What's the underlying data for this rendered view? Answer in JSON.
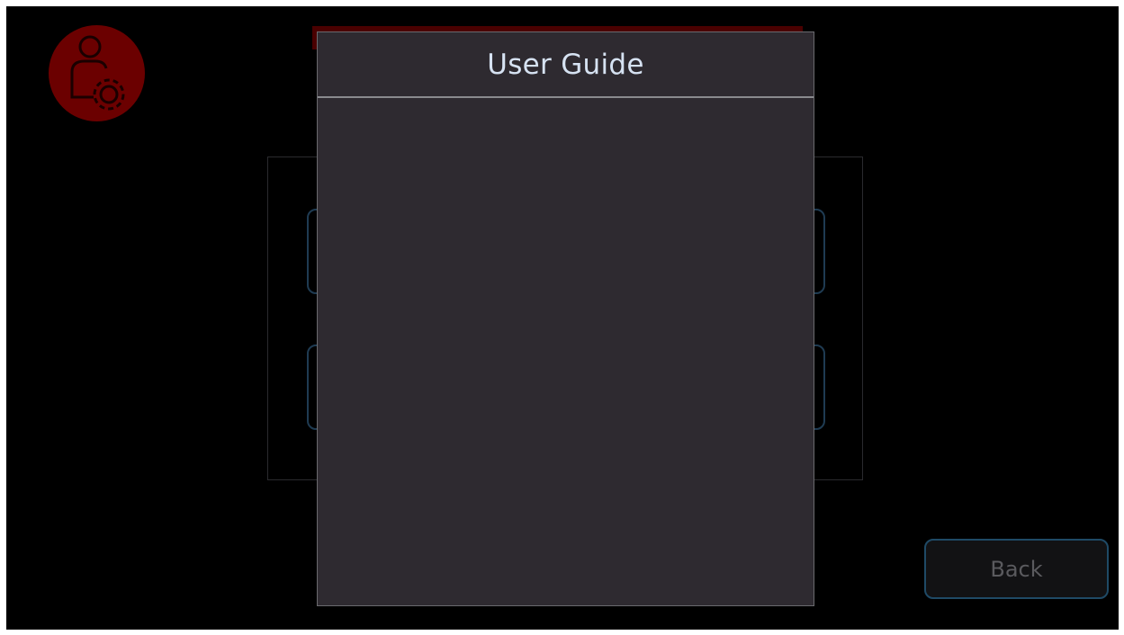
{
  "modal": {
    "title": "User Guide"
  },
  "footer": {
    "back_label": "Back"
  },
  "icons": {
    "avatar": "user-settings-icon",
    "logo": "brand-logo"
  },
  "colors": {
    "background": "#000000",
    "modal_background": "#2e2a30",
    "modal_title": "#d6e2f2",
    "accent_red": "#6b0000",
    "button_border": "#1f4a66"
  }
}
